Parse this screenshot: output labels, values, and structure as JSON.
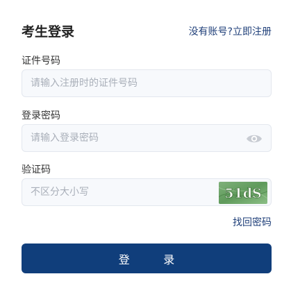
{
  "header": {
    "title": "考生登录",
    "register_link": "没有账号?立即注册"
  },
  "fields": {
    "id_number": {
      "label": "证件号码",
      "placeholder": "请输入注册时的证件号码",
      "value": ""
    },
    "password": {
      "label": "登录密码",
      "placeholder": "请输入登录密码",
      "value": "",
      "toggle_icon": "eye-icon"
    },
    "captcha": {
      "label": "验证码",
      "placeholder": "不区分大小写",
      "value": "",
      "image_text": "51dS"
    }
  },
  "forgot_password_link": "找回密码",
  "login_button": "登 录",
  "colors": {
    "primary": "#103e7b",
    "link": "#1f3f79",
    "input_bg": "#f7f9fc",
    "input_border": "#e3e7ee",
    "placeholder": "#a9afb9"
  }
}
